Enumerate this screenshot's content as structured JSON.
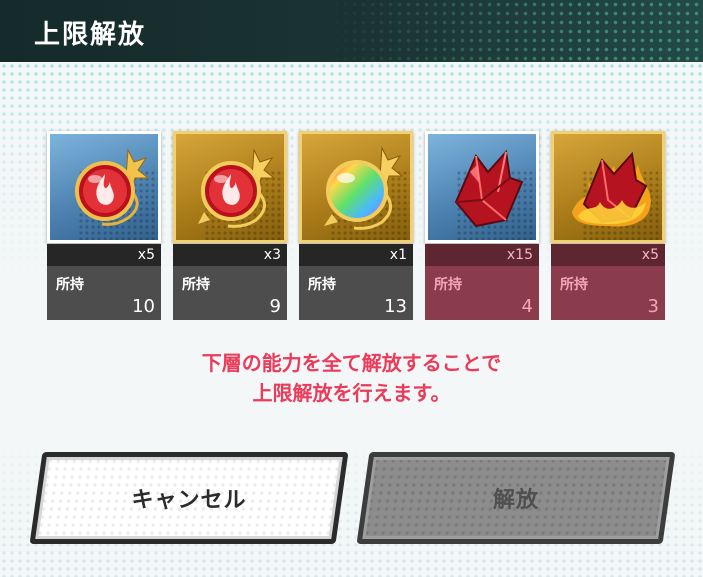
{
  "header": {
    "title": "上限解放"
  },
  "items": [
    {
      "quantity": "x5",
      "stock_label": "所持",
      "stock": "10",
      "frame": "blue",
      "icon": "red-fire-orb-icon",
      "sufficient": true
    },
    {
      "quantity": "x3",
      "stock_label": "所持",
      "stock": "9",
      "frame": "gold",
      "icon": "red-fire-orb-icon",
      "sufficient": true
    },
    {
      "quantity": "x1",
      "stock_label": "所持",
      "stock": "13",
      "frame": "gold",
      "icon": "rainbow-orb-icon",
      "sufficient": true
    },
    {
      "quantity": "x15",
      "stock_label": "所持",
      "stock": "4",
      "frame": "blue",
      "icon": "red-crystal-icon",
      "sufficient": false
    },
    {
      "quantity": "x5",
      "stock_label": "所持",
      "stock": "3",
      "frame": "gold",
      "icon": "flaming-crystal-icon",
      "sufficient": false
    }
  ],
  "message": {
    "line1": "下層の能力を全て解放することで",
    "line2": "上限解放を行えます。"
  },
  "buttons": {
    "cancel": "キャンセル",
    "release": "解放"
  },
  "colors": {
    "header_bg": "#1b3433",
    "message": "#ea3b5a",
    "insufficient": "#8b3c4c"
  }
}
